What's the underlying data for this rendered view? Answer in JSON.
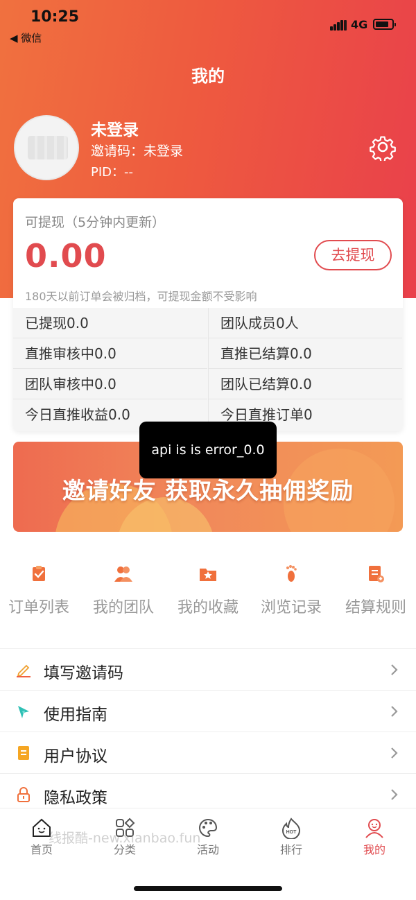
{
  "status_bar": {
    "time": "10:25",
    "back_label": "◀ 微信",
    "network": "4G",
    "battery_level": 0.8
  },
  "header": {
    "title": "我的"
  },
  "profile": {
    "name": "未登录",
    "invite_code": "邀请码：未登录",
    "pid": "PID：--"
  },
  "wallet": {
    "label": "可提现（5分钟内更新）",
    "amount": "0.00",
    "withdraw_button": "去提现",
    "note": "180天以前订单会被归档，可提现金额不受影响",
    "stats": [
      [
        "已提现0.0",
        "团队成员0人"
      ],
      [
        "直推审核中0.0",
        "直推已结算0.0"
      ],
      [
        "团队审核中0.0",
        "团队已结算0.0"
      ],
      [
        "今日直推收益0.0",
        "今日直推订单0"
      ]
    ]
  },
  "banner": {
    "text": "邀请好友 获取永久抽佣奖励"
  },
  "toast": {
    "text": "api is is error_0.0"
  },
  "quick_menu": [
    {
      "label": "订单列表",
      "icon": "clipboard-check-icon"
    },
    {
      "label": "我的团队",
      "icon": "team-icon"
    },
    {
      "label": "我的收藏",
      "icon": "star-folder-icon"
    },
    {
      "label": "浏览记录",
      "icon": "footprint-icon"
    },
    {
      "label": "结算规则",
      "icon": "settlement-icon"
    }
  ],
  "menu_list": [
    {
      "label": "填写邀请码",
      "icon": "pencil-icon"
    },
    {
      "label": "使用指南",
      "icon": "compass-icon"
    },
    {
      "label": "用户协议",
      "icon": "document-icon"
    },
    {
      "label": "隐私政策",
      "icon": "lock-icon"
    }
  ],
  "tabbar": {
    "items": [
      {
        "label": "首页",
        "icon": "home-icon"
      },
      {
        "label": "分类",
        "icon": "grid-icon"
      },
      {
        "label": "活动",
        "icon": "palette-icon"
      },
      {
        "label": "排行",
        "icon": "hot-icon"
      },
      {
        "label": "我的",
        "icon": "user-icon"
      }
    ],
    "active": "我的",
    "watermark": "线报酷-new.xianbao.fun"
  },
  "colors": {
    "accent": "#e14b4f",
    "hero_start": "#f0713f",
    "hero_end": "#e9404b",
    "icon_orange": "#f0703c"
  }
}
